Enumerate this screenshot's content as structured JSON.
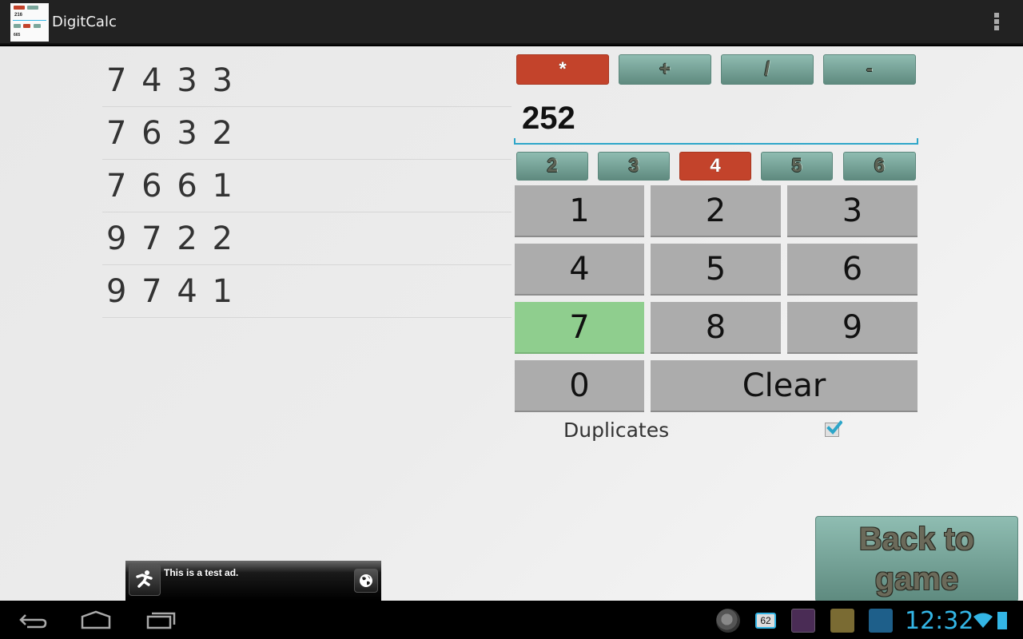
{
  "app": {
    "title": "DigitCalc",
    "icon": "digitcalc-app-icon",
    "icon_preview_value": "216",
    "icon_preview_bottom": "665"
  },
  "actionbar": {
    "overflow_icon": "overflow-menu-icon"
  },
  "results": {
    "items": [
      "7 4 3 3",
      "7 6 3 2",
      "7 6 6 1",
      "9 7 2 2",
      "9 7 4 1"
    ]
  },
  "operators": {
    "items": [
      {
        "label": "*",
        "selected": true
      },
      {
        "label": "+",
        "selected": false
      },
      {
        "label": "/",
        "selected": false
      },
      {
        "label": "-",
        "selected": false
      }
    ]
  },
  "target": {
    "value": "252"
  },
  "digit_count": {
    "items": [
      {
        "label": "2",
        "selected": false
      },
      {
        "label": "3",
        "selected": false
      },
      {
        "label": "4",
        "selected": true
      },
      {
        "label": "5",
        "selected": false
      },
      {
        "label": "6",
        "selected": false
      }
    ]
  },
  "keypad": {
    "keys": [
      "1",
      "2",
      "3",
      "4",
      "5",
      "6",
      "7",
      "8",
      "9",
      "0"
    ],
    "highlighted_key": "7",
    "clear_label": "Clear"
  },
  "options": {
    "duplicates_label": "Duplicates",
    "duplicates_checked": true
  },
  "ad": {
    "text": "This is a test ad.",
    "icon": "running-man-icon",
    "globe_icon": "globe-icon"
  },
  "back_button": {
    "label": "Back to game"
  },
  "colors": {
    "selected": "#c3432b",
    "chip": "#7aa69b",
    "key": "#acacac",
    "key_highlight": "#8fce8e",
    "accent": "#33b5e5"
  },
  "system_bar": {
    "nav": [
      "back-icon",
      "home-icon",
      "recent-apps-icon"
    ],
    "notifications": [
      "bittorrent-icon",
      "battery-62-icon",
      "viber-icon",
      "app-notification-icon",
      "keypad-app-icon"
    ],
    "battery_badge": "62",
    "clock": "12:32",
    "status_icons": [
      "wifi-icon",
      "battery-icon"
    ]
  }
}
